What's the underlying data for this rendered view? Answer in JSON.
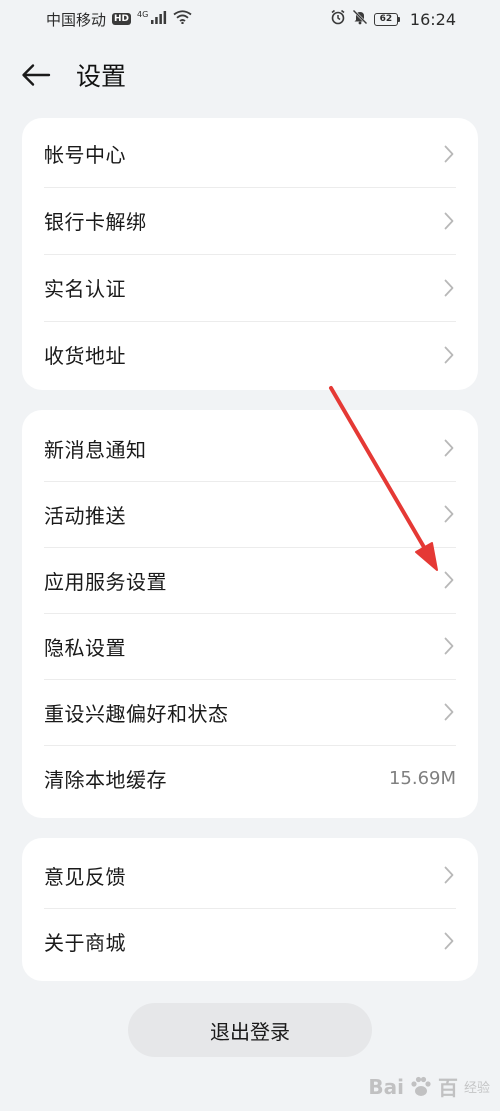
{
  "status_bar": {
    "carrier": "中国移动",
    "hd": "HD",
    "network": "4G",
    "battery": "62",
    "time": "16:24"
  },
  "header": {
    "title": "设置"
  },
  "sections": [
    {
      "items": [
        {
          "label": "帐号中心"
        },
        {
          "label": "银行卡解绑"
        },
        {
          "label": "实名认证"
        },
        {
          "label": "收货地址"
        }
      ]
    },
    {
      "items": [
        {
          "label": "新消息通知"
        },
        {
          "label": "活动推送"
        },
        {
          "label": "应用服务设置"
        },
        {
          "label": "隐私设置"
        },
        {
          "label": "重设兴趣偏好和状态"
        },
        {
          "label": "清除本地缓存",
          "value": "15.69M"
        }
      ]
    },
    {
      "items": [
        {
          "label": "意见反馈"
        },
        {
          "label": "关于商城"
        }
      ]
    }
  ],
  "logout_label": "退出登录",
  "watermark": {
    "brand": "Bai",
    "brand_end": "百",
    "sub": "经验"
  },
  "colors": {
    "background": "#f1f3f5",
    "card": "#ffffff",
    "annotation_arrow": "#e53935",
    "chevron": "#b8b8b8"
  }
}
